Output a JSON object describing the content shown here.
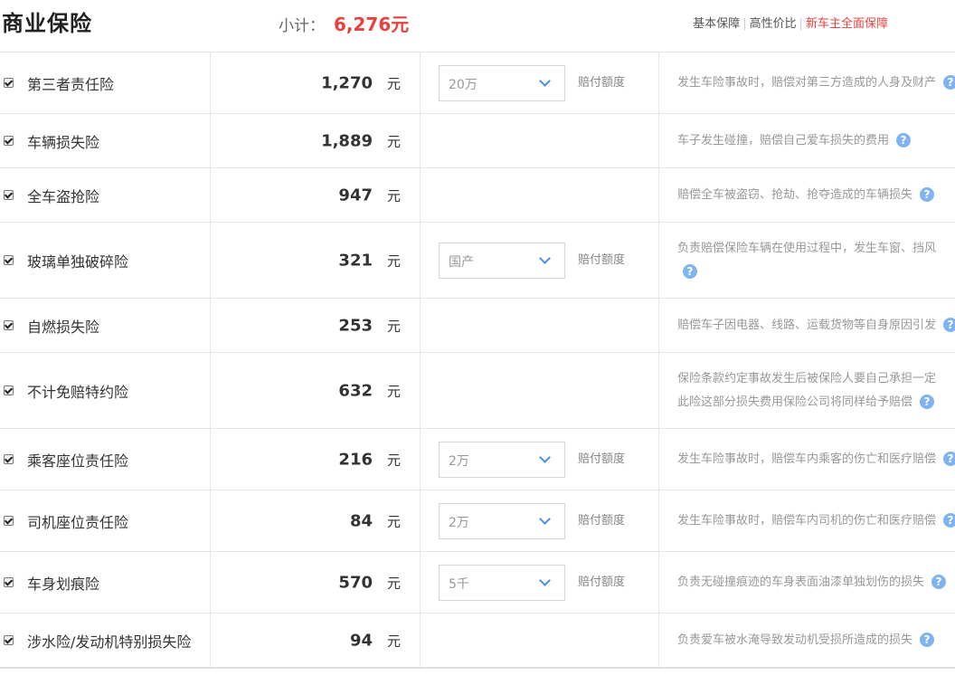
{
  "header": {
    "title": "商业保险",
    "subtotal_label": "小计：",
    "subtotal_value": "6,276元",
    "links": [
      "基本保障",
      "高性价比",
      "新车主全面保障"
    ]
  },
  "help_icon": "?",
  "rows": [
    {
      "name": "第三者责任险",
      "price": "1,270",
      "unit": "元",
      "select": "20万",
      "coverage_label": "赔付额度",
      "desc_lines": [
        "发生车险事故时，赔偿对第三方造成的人身及财产"
      ]
    },
    {
      "name": "车辆损失险",
      "price": "1,889",
      "unit": "元",
      "select": "",
      "coverage_label": "",
      "desc_lines": [
        "车子发生碰撞，赔偿自己爱车损失的费用"
      ]
    },
    {
      "name": "全车盗抢险",
      "price": "947",
      "unit": "元",
      "select": "",
      "coverage_label": "",
      "desc_lines": [
        "赔偿全车被盗窃、抢劫、抢夺造成的车辆损失"
      ]
    },
    {
      "name": "玻璃单独破碎险",
      "price": "321",
      "unit": "元",
      "select": "国产",
      "coverage_label": "赔付额度",
      "desc_lines": [
        "负责赔偿保险车辆在使用过程中，发生车窗、挡风"
      ]
    },
    {
      "name": "自燃损失险",
      "price": "253",
      "unit": "元",
      "select": "",
      "coverage_label": "",
      "desc_lines": [
        "赔偿车子因电器、线路、运载货物等自身原因引发"
      ]
    },
    {
      "name": "不计免赔特约险",
      "price": "632",
      "unit": "元",
      "select": "",
      "coverage_label": "",
      "desc_lines": [
        "保险条款约定事故发生后被保险人要自己承担一定",
        "此险这部分损失费用保险公司将同样给予赔偿"
      ]
    },
    {
      "name": "乘客座位责任险",
      "price": "216",
      "unit": "元",
      "select": "2万",
      "coverage_label": "赔付额度",
      "desc_lines": [
        "发生车险事故时，赔偿车内乘客的伤亡和医疗赔偿"
      ]
    },
    {
      "name": "司机座位责任险",
      "price": "84",
      "unit": "元",
      "select": "2万",
      "coverage_label": "赔付额度",
      "desc_lines": [
        "发生车险事故时，赔偿车内司机的伤亡和医疗赔偿"
      ]
    },
    {
      "name": "车身划痕险",
      "price": "570",
      "unit": "元",
      "select": "5千",
      "coverage_label": "赔付额度",
      "desc_lines": [
        "负责无碰撞痕迹的车身表面油漆单独划伤的损失"
      ]
    },
    {
      "name": "涉水险/发动机特别损失险",
      "price": "94",
      "unit": "元",
      "select": "",
      "coverage_label": "",
      "desc_lines": [
        "负责爱车被水淹导致发动机受损所造成的损失"
      ]
    }
  ],
  "colors": {
    "accent_red": "#e8423f",
    "help_blue": "#7fb4f0",
    "chevron_blue": "#4a90e2",
    "border": "#e6e6e6"
  }
}
